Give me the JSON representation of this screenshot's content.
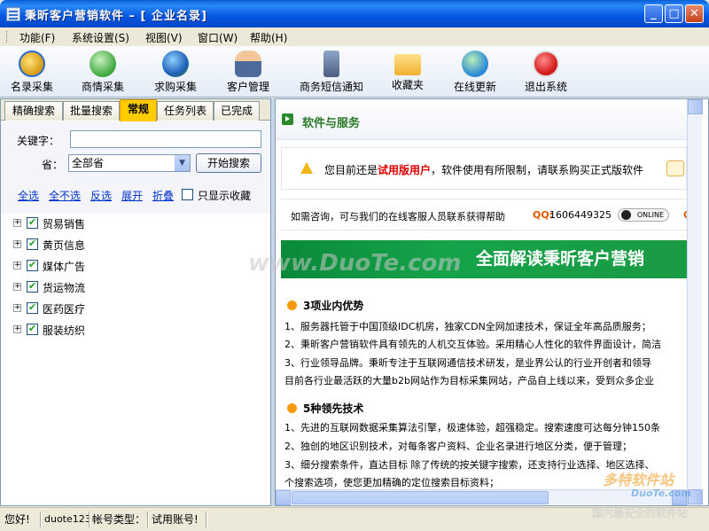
{
  "window": {
    "title": "秉昕客户营销软件 – [ 企业名录]"
  },
  "menu": [
    "功能(F)",
    "系统设置(S)",
    "视图(V)",
    "窗口(W)",
    "帮助(H)"
  ],
  "toolbar": [
    "名录采集",
    "商情采集",
    "求购采集",
    "客户管理",
    "商务短信通知",
    "收藏夹",
    "在线更新",
    "退出系统"
  ],
  "tabs": [
    "精确搜索",
    "批量搜索",
    "常规",
    "任务列表",
    "已完成"
  ],
  "form": {
    "keyword_label": "关键字：",
    "keyword_value": "",
    "province_label": "省：",
    "province_value": "全部省",
    "search_button": "开始搜索"
  },
  "actions": [
    "全选",
    "全不选",
    "反选",
    "展开",
    "折叠"
  ],
  "only_fav": "只显示收藏",
  "tree": [
    "贸易销售",
    "黄页信息",
    "媒体广告",
    "货运物流",
    "医药医疗",
    "服装纺织"
  ],
  "content": {
    "section_title": "软件与服务",
    "notice_pre": "您目前还是",
    "notice_red": "试用版用户",
    "notice_post": "，软件使用有所限制，请联系购买正式版软件",
    "consult": "如需咨询，可与我们的在线客服人员联系获得帮助",
    "qq_label": "QQ:",
    "qq_number": "1606449325",
    "qq_status": "ONLINE",
    "qq_label2": "Q",
    "banner": "全面解读秉昕客户营销",
    "sub1": "3项业内优势",
    "p1": [
      "1、服务器托管于中国顶级IDC机房，独家CDN全网加速技术，保证全年高品质服务；",
      "2、秉昕客户营销软件具有领先的人机交互体验。采用精心人性化的软件界面设计，简洁",
      "3、行业领导品牌。秉昕专注于互联网通信技术研发，是业界公认的行业开创者和领导",
      "目前各行业最活跃的大量b2b网站作为目标采集网站，产品自上线以来，受到众多企业"
    ],
    "sub2": "5种领先技术",
    "p2": [
      "1、先进的互联网数据采集算法引擎，极速体验，超强稳定。搜索速度可达每分钟150条",
      "2、独创的地区识别技术，对每条客户资料、企业名录进行地区分类，便于管理；",
      "3、细分搜索条件，直达目标 除了传统的按关键字搜索，还支持行业选择、地区选择、",
      "个搜索选项，使您更加精确的定位搜索目标资料；"
    ]
  },
  "status": [
    "您好!",
    "duote123",
    "帐号类型：",
    "试用账号!"
  ],
  "watermarks": {
    "duote": "www.DuoTe.com",
    "brand": "多特软件站",
    "url": "DuoTe.com",
    "slogan": "国内最安全的软件站"
  },
  "colors": {
    "titlebar": "#0a5fd8",
    "active_tab": "#ffcc00",
    "banner": "#16a34a",
    "link": "#0033cc"
  }
}
